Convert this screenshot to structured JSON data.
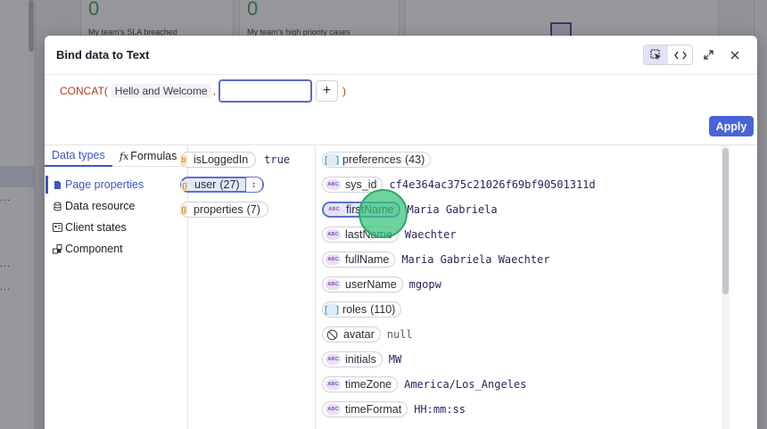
{
  "background": {
    "cards": [
      {
        "value": "0",
        "label": "My team's SLA breached"
      },
      {
        "value": "0",
        "label": "My team's high priority cases"
      }
    ],
    "sidebar_dots": [
      "...",
      "...",
      "..."
    ]
  },
  "modal": {
    "title": "Bind data to Text",
    "toolbar": {
      "select_icon": "cursor-select-icon",
      "code_icon": "code-icon",
      "expand_icon": "expand-icon",
      "close_icon": "close-icon"
    },
    "formula": {
      "function_open": "CONCAT(",
      "arg1": "Hello and Welcome",
      "separator": ",",
      "arg2_value": "",
      "add_label": "+",
      "function_close": ")"
    },
    "apply_label": "Apply",
    "tabs": [
      {
        "label": "Data types"
      },
      {
        "icon": "fx",
        "label": "Formulas"
      }
    ],
    "nav": [
      {
        "label": "Page properties",
        "icon": "page-icon",
        "active": true
      },
      {
        "label": "Data resource",
        "icon": "database-icon"
      },
      {
        "label": "Client states",
        "icon": "client-states-icon"
      },
      {
        "label": "Component",
        "icon": "component-icon"
      }
    ],
    "middle": [
      {
        "key": "isLoggedIn",
        "value": "true"
      },
      {
        "key": "user",
        "count": "(27)",
        "selected": true
      },
      {
        "key": "properties",
        "count": "(7)"
      }
    ],
    "fields": [
      {
        "key": "preferences",
        "type": "array",
        "count": "(43)"
      },
      {
        "key": "sys_id",
        "type": "string",
        "value": "cf4e364ac375c21026f69bf90501311d"
      },
      {
        "key": "firstName",
        "type": "string",
        "value": "Maria Gabriela",
        "selected": true
      },
      {
        "key": "lastName",
        "type": "string",
        "value": "Waechter"
      },
      {
        "key": "fullName",
        "type": "string",
        "value": "Maria Gabriela Waechter"
      },
      {
        "key": "userName",
        "type": "string",
        "value": "mgopw"
      },
      {
        "key": "roles",
        "type": "array",
        "count": "(110)"
      },
      {
        "key": "avatar",
        "type": "null",
        "value": "null"
      },
      {
        "key": "initials",
        "type": "string",
        "value": "MW"
      },
      {
        "key": "timeZone",
        "type": "string",
        "value": "America/Los_Angeles"
      },
      {
        "key": "timeFormat",
        "type": "string",
        "value": "HH:mm:ss"
      }
    ],
    "type_badges": {
      "string": "ABC",
      "array": "[ ]"
    },
    "accent_color": "#4a64d8"
  }
}
